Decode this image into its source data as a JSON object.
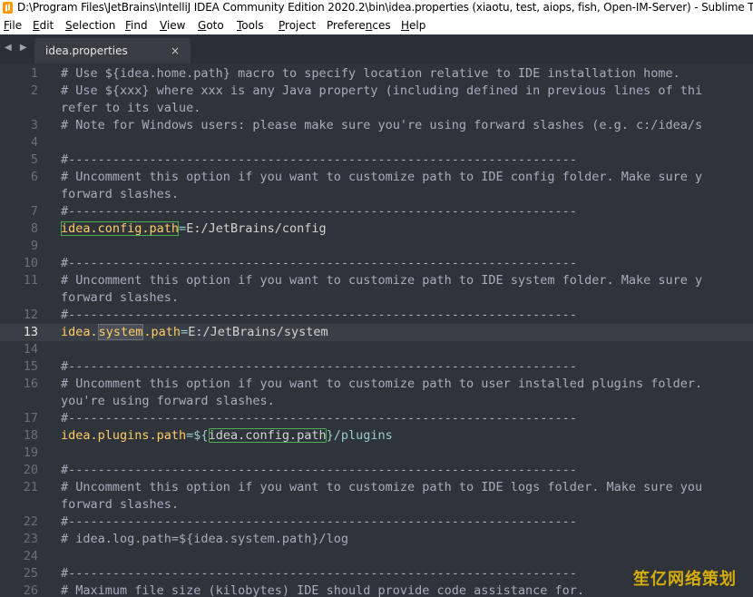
{
  "window": {
    "title": "D:\\Program Files\\JetBrains\\IntelliJ IDEA Community Edition 2020.2\\bin\\idea.properties (xiaotu, test, aiops, fish, Open-IM-Server) - Sublime T",
    "app_icon": "sublime-text-icon"
  },
  "menu": [
    {
      "label": "File",
      "acc": "F",
      "rest": "ile"
    },
    {
      "label": "Edit",
      "acc": "E",
      "rest": "dit"
    },
    {
      "label": "Selection",
      "acc": "S",
      "rest": "election"
    },
    {
      "label": "Find",
      "acc": "F",
      "rest": "ind",
      "accpos": 1
    },
    {
      "label": "View",
      "acc": "V",
      "rest": "iew"
    },
    {
      "label": "Goto",
      "acc": "G",
      "rest": "oto"
    },
    {
      "label": "Tools",
      "acc": "T",
      "rest": "ools"
    },
    {
      "label": "Project",
      "acc": "P",
      "rest": "roject"
    },
    {
      "label": "Preferences",
      "acc": "n",
      "rest": "Preferences"
    },
    {
      "label": "Help",
      "acc": "H",
      "rest": "elp"
    }
  ],
  "tabs": {
    "nav": "◀ ▶",
    "active": {
      "label": "idea.properties",
      "close": "×"
    }
  },
  "editor": {
    "active_line": 13,
    "lines": [
      {
        "n": "1",
        "text": "# Use ${idea.home.path} macro to specify location relative to IDE installation home."
      },
      {
        "n": "2",
        "text": "# Use ${xxx} where xxx is any Java property (including defined in previous lines of thi"
      },
      {
        "n": "",
        "text": "refer to its value."
      },
      {
        "n": "3",
        "text": "# Note for Windows users: please make sure you're using forward slashes (e.g. c:/idea/s"
      },
      {
        "n": "4",
        "text": ""
      },
      {
        "n": "5",
        "text": "#---------------------------------------------------------------------"
      },
      {
        "n": "6",
        "text": "# Uncomment this option if you want to customize path to IDE config folder. Make sure y"
      },
      {
        "n": "",
        "text": "forward slashes."
      },
      {
        "n": "7",
        "text": "#---------------------------------------------------------------------"
      },
      {
        "n": "8",
        "key": "idea.config.path",
        "op": "=",
        "val": "E:/JetBrains/config"
      },
      {
        "n": "9",
        "text": ""
      },
      {
        "n": "10",
        "text": "#---------------------------------------------------------------------"
      },
      {
        "n": "11",
        "text": "# Uncomment this option if you want to customize path to IDE system folder. Make sure y"
      },
      {
        "n": "",
        "text": "forward slashes."
      },
      {
        "n": "12",
        "text": "#---------------------------------------------------------------------"
      },
      {
        "n": "13",
        "key_pre": "idea.",
        "key_sel": "system",
        "key_post": ".path",
        "op": "=",
        "val": "E:/JetBrains/system"
      },
      {
        "n": "14",
        "text": ""
      },
      {
        "n": "15",
        "text": "#---------------------------------------------------------------------"
      },
      {
        "n": "16",
        "text": "# Uncomment this option if you want to customize path to user installed plugins folder."
      },
      {
        "n": "",
        "text": "you're using forward slashes."
      },
      {
        "n": "17",
        "text": "#---------------------------------------------------------------------"
      },
      {
        "n": "18",
        "key": "idea.plugins.path",
        "op": "=${",
        "ref": "idea.config.path",
        "tail": "}/plugins"
      },
      {
        "n": "19",
        "text": ""
      },
      {
        "n": "20",
        "text": "#---------------------------------------------------------------------"
      },
      {
        "n": "21",
        "text": "# Uncomment this option if you want to customize path to IDE logs folder. Make sure you"
      },
      {
        "n": "",
        "text": "forward slashes."
      },
      {
        "n": "22",
        "text": "#---------------------------------------------------------------------"
      },
      {
        "n": "23",
        "text": "# idea.log.path=${idea.system.path}/log"
      },
      {
        "n": "24",
        "text": ""
      },
      {
        "n": "25",
        "text": "#---------------------------------------------------------------------"
      },
      {
        "n": "26",
        "text": "# Maximum file size (kilobytes) IDE should provide code assistance for."
      }
    ]
  },
  "watermark": "笙亿网络策划",
  "colors": {
    "background": "#2f343a",
    "comment": "#a7adba",
    "key": "#ffcc66",
    "operator": "#99cccc",
    "match_outline": "#4caf50",
    "watermark": "#f2c200"
  }
}
